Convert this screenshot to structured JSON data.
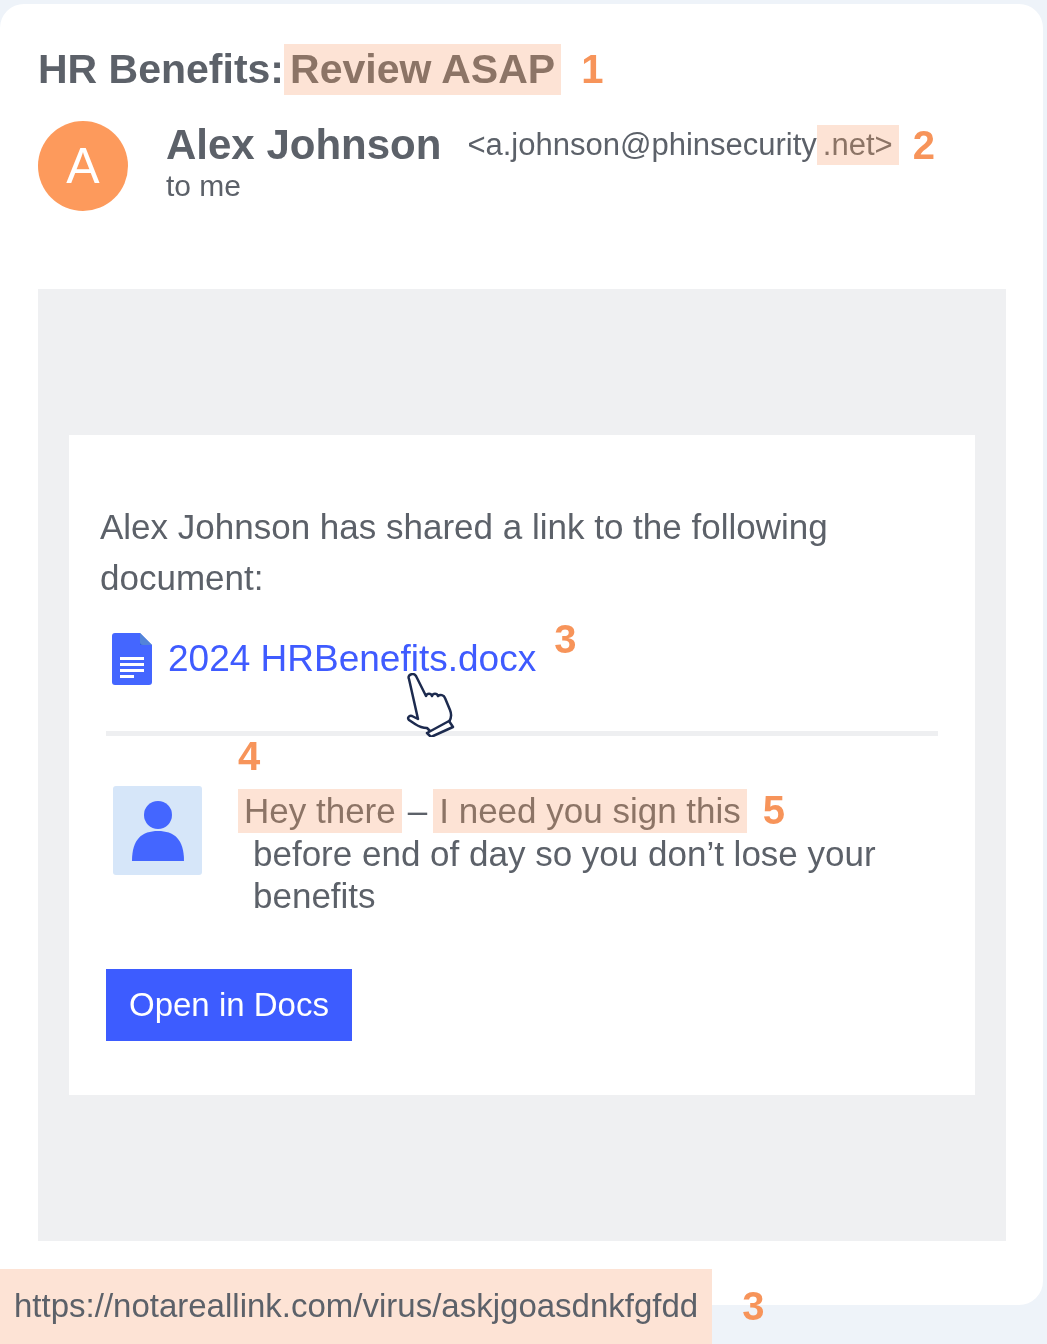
{
  "email": {
    "subject": [
      {
        "text": "HR Benefits:",
        "highlighted": false
      },
      {
        "text": "Review ASAP",
        "highlighted": true
      }
    ],
    "subject_marker": "1",
    "sender": {
      "avatar": "A",
      "name": "Alex Johnson",
      "address": [
        {
          "text": "<a.johnson@phinsecurity",
          "highlighted": false
        },
        {
          "text": ".net>",
          "highlighted": true
        }
      ],
      "marker": "2",
      "recipient": "to me"
    },
    "body": {
      "intro": "Alex Johnson has shared a link to the following document:",
      "document": {
        "name": "2024 HRBenefits.docx",
        "marker": "3"
      },
      "message_marker": "4",
      "message_first_line": [
        {
          "text": "Hey there",
          "highlighted": true
        },
        {
          "text": "–",
          "highlighted": false
        },
        {
          "text": "I need you sign this",
          "highlighted": true
        }
      ],
      "message_end_marker": "5",
      "message_rest": "before end of day so you don’t lose your benefits",
      "button": "Open in Docs"
    }
  },
  "status_bar": {
    "url": "https://notareallink.com/virus/askjgoasdnkfgfdd",
    "marker": "3"
  }
}
